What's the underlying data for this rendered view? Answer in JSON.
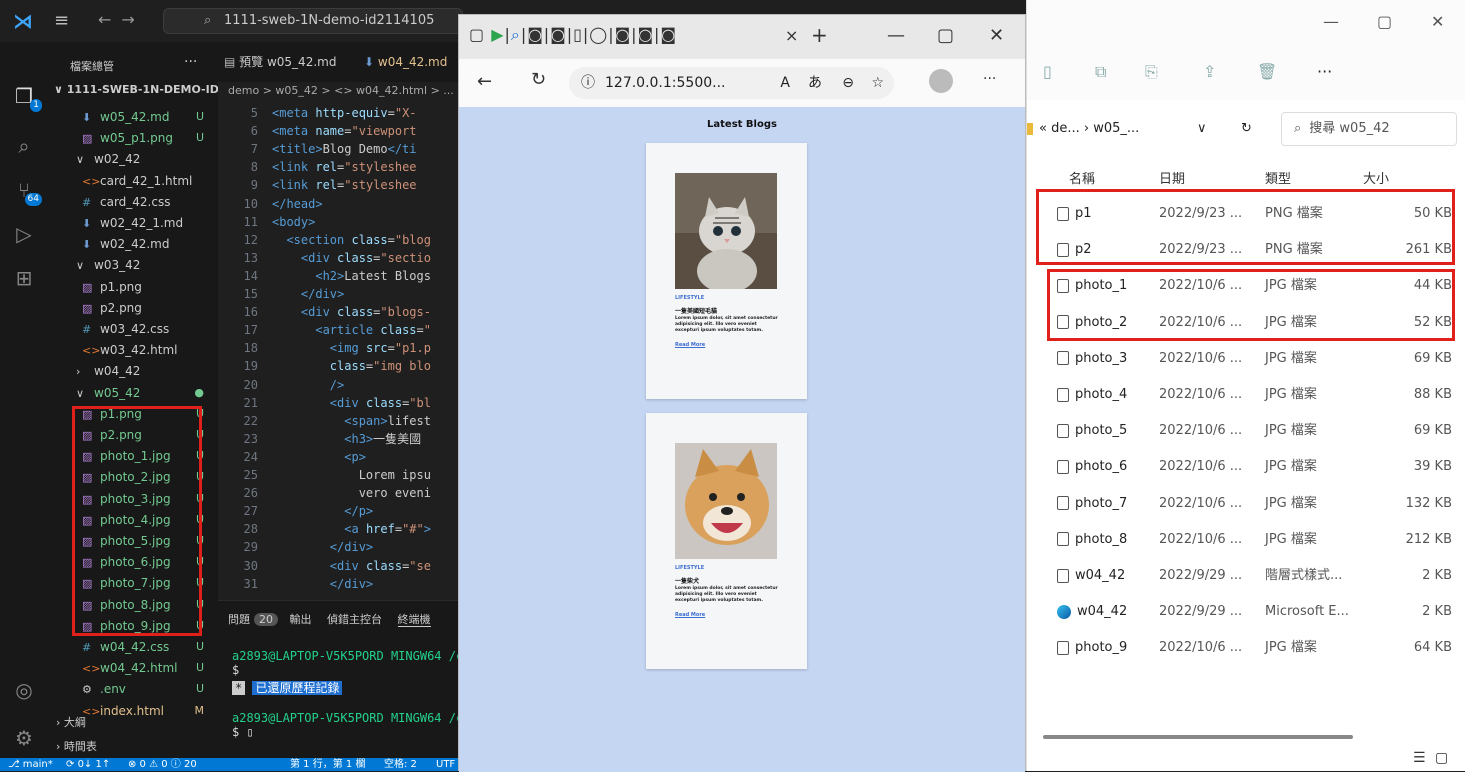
{
  "vscode": {
    "command_center": "1111-sweb-1N-demo-id2114105",
    "sidebar_title": "檔案總管",
    "sidebar_dots": "···",
    "project": "1111-SWEB-1N-DEMO-ID2...",
    "tree": [
      {
        "label": "w05_42.md",
        "icon": "md",
        "status": "U",
        "color": "green"
      },
      {
        "label": "w05_p1.png",
        "icon": "img",
        "status": "U",
        "color": "green"
      },
      {
        "label": "w02_42",
        "icon": "folder-open",
        "status": "",
        "color": "gray"
      },
      {
        "label": "card_42_1.html",
        "icon": "html",
        "status": "",
        "color": "gray"
      },
      {
        "label": "card_42.css",
        "icon": "css",
        "status": "",
        "color": "gray"
      },
      {
        "label": "w02_42_1.md",
        "icon": "md",
        "status": "",
        "color": "gray"
      },
      {
        "label": "w02_42.md",
        "icon": "md",
        "status": "",
        "color": "gray"
      },
      {
        "label": "w03_42",
        "icon": "folder-open",
        "status": "",
        "color": "gray"
      },
      {
        "label": "p1.png",
        "icon": "img",
        "status": "",
        "color": "gray"
      },
      {
        "label": "p2.png",
        "icon": "img",
        "status": "",
        "color": "gray"
      },
      {
        "label": "w03_42.css",
        "icon": "css",
        "status": "",
        "color": "gray"
      },
      {
        "label": "w03_42.html",
        "icon": "html",
        "status": "",
        "color": "gray"
      },
      {
        "label": "w04_42",
        "icon": "folder-closed",
        "status": "",
        "color": "gray"
      },
      {
        "label": "w05_42",
        "icon": "folder-open",
        "status": "●",
        "color": "green"
      },
      {
        "label": "p1.png",
        "icon": "img",
        "status": "U",
        "color": "green"
      },
      {
        "label": "p2.png",
        "icon": "img",
        "status": "U",
        "color": "green"
      },
      {
        "label": "photo_1.jpg",
        "icon": "img",
        "status": "U",
        "color": "green"
      },
      {
        "label": "photo_2.jpg",
        "icon": "img",
        "status": "U",
        "color": "green"
      },
      {
        "label": "photo_3.jpg",
        "icon": "img",
        "status": "U",
        "color": "green"
      },
      {
        "label": "photo_4.jpg",
        "icon": "img",
        "status": "U",
        "color": "green"
      },
      {
        "label": "photo_5.jpg",
        "icon": "img",
        "status": "U",
        "color": "green"
      },
      {
        "label": "photo_6.jpg",
        "icon": "img",
        "status": "U",
        "color": "green"
      },
      {
        "label": "photo_7.jpg",
        "icon": "img",
        "status": "U",
        "color": "green"
      },
      {
        "label": "photo_8.jpg",
        "icon": "img",
        "status": "U",
        "color": "green"
      },
      {
        "label": "photo_9.jpg",
        "icon": "img",
        "status": "U",
        "color": "green"
      },
      {
        "label": "w04_42.css",
        "icon": "css",
        "status": "U",
        "color": "green"
      },
      {
        "label": "w04_42.html",
        "icon": "html",
        "status": "U",
        "color": "green"
      },
      {
        "label": ".env",
        "icon": "gear",
        "status": "U",
        "color": "green"
      },
      {
        "label": "index.html",
        "icon": "html",
        "status": "M",
        "color": "yellow"
      }
    ],
    "outline": [
      "大綱",
      "時間表"
    ],
    "tabs": [
      "預覽 w05_42.md",
      "w04_42.md"
    ],
    "breadcrumb": "demo > w05_42 > <> w04_42.html > ...",
    "code": [
      {
        "n": "5",
        "html": "<span class='tg'>&lt;meta</span> <span class='at'>http-equiv</span>=<span class='sv'>\"X-</span>"
      },
      {
        "n": "6",
        "html": "<span class='tg'>&lt;meta</span> <span class='at'>name</span>=<span class='sv'>\"viewport</span>"
      },
      {
        "n": "7",
        "html": "<span class='tg'>&lt;title&gt;</span><span class='tx'>Blog Demo</span><span class='tg'>&lt;/ti</span>"
      },
      {
        "n": "8",
        "html": "<span class='tg'>&lt;link</span> <span class='at'>rel</span>=<span class='sv'>\"styleshee</span>"
      },
      {
        "n": "9",
        "html": "<span class='tg'>&lt;link</span> <span class='at'>rel</span>=<span class='sv'>\"styleshee</span>"
      },
      {
        "n": "10",
        "html": "<span class='tg'>&lt;/head&gt;</span>"
      },
      {
        "n": "11",
        "html": "<span class='tg'>&lt;body&gt;</span>"
      },
      {
        "n": "12",
        "html": "  <span class='tg'>&lt;section</span> <span class='at'>class</span>=<span class='sv'>\"blog</span>"
      },
      {
        "n": "13",
        "html": "    <span class='tg'>&lt;div</span> <span class='at'>class</span>=<span class='sv'>\"sectio</span>"
      },
      {
        "n": "14",
        "html": "      <span class='tg'>&lt;h2&gt;</span><span class='tx'>Latest Blogs</span>"
      },
      {
        "n": "15",
        "html": "    <span class='tg'>&lt;/div&gt;</span>"
      },
      {
        "n": "16",
        "html": "    <span class='tg'>&lt;div</span> <span class='at'>class</span>=<span class='sv'>\"blogs-</span>"
      },
      {
        "n": "17",
        "html": "      <span class='tg'>&lt;article</span> <span class='at'>class</span>=<span class='sv'>\"</span>"
      },
      {
        "n": "18",
        "html": "        <span class='tg'>&lt;img</span> <span class='at'>src</span>=<span class='sv'>\"p1.p</span>"
      },
      {
        "n": "19",
        "html": "        <span class='at'>class</span>=<span class='sv'>\"img blo</span>"
      },
      {
        "n": "20",
        "html": "        <span class='tg'>/&gt;</span>"
      },
      {
        "n": "21",
        "html": "        <span class='tg'>&lt;div</span> <span class='at'>class</span>=<span class='sv'>\"bl</span>"
      },
      {
        "n": "22",
        "html": "          <span class='tg'>&lt;span&gt;</span><span class='tx'>lifest</span>"
      },
      {
        "n": "23",
        "html": "          <span class='tg'>&lt;h3&gt;</span><span class='tx'>一隻美國</span>"
      },
      {
        "n": "24",
        "html": "          <span class='tg'>&lt;p&gt;</span>"
      },
      {
        "n": "25",
        "html": "            <span class='tx'>Lorem ipsu</span>"
      },
      {
        "n": "26",
        "html": "            <span class='tx'>vero eveni</span>"
      },
      {
        "n": "27",
        "html": "          <span class='tg'>&lt;/p&gt;</span>"
      },
      {
        "n": "28",
        "html": "          <span class='tg'>&lt;a</span> <span class='at'>href</span>=<span class='sv'>\"#\"</span><span class='tg'>&gt;</span>"
      },
      {
        "n": "29",
        "html": "        <span class='tg'>&lt;/div&gt;</span>"
      },
      {
        "n": "30",
        "html": "        <span class='tg'>&lt;div</span> <span class='at'>class</span>=<span class='sv'>\"se</span>"
      },
      {
        "n": "31",
        "html": "        <span class='tg'>&lt;/div&gt;</span>"
      }
    ],
    "panel": {
      "problems": "問題",
      "problems_count": "20",
      "output": "輸出",
      "debug": "偵錯主控台",
      "terminal": "終端機"
    },
    "terminal_lines": [
      "a2893@LAPTOP-V5K5PORD MINGW64 /c/",
      "$",
      "已還原歷程記錄",
      "a2893@LAPTOP-V5K5PORD MINGW64 /c/",
      "$ ▯"
    ],
    "status": {
      "branch": "main*",
      "sync": "0↓ 1↑",
      "problems": "⊗ 0 ⚠ 0 ⓘ 20",
      "position": "第 1 行，第 1 欄",
      "spaces": "空格: 2",
      "encoding": "UTF"
    }
  },
  "browser": {
    "url": "127.0.0.1:5500...",
    "page_title": "Latest Blogs",
    "cards": [
      {
        "category": "LIFESTYLE",
        "title": "一隻美國短毛貓",
        "body": "Lorem ipsum dolor, sit amet consectetur adipisicing elit. Illo vero eveniet excepturi ipsum voluptates totam.",
        "link": "Read More",
        "image": "cat-photo"
      },
      {
        "category": "LIFESTYLE",
        "title": "一隻柴犬",
        "body": "Lorem ipsum dolor, sit amet consectetur adipisicing elit. Illo vero eveniet excepturi ipsum voluptates totam.",
        "link": "Read More",
        "image": "dog-photo"
      }
    ]
  },
  "explorer": {
    "address": "« de... › w05_...",
    "search": "搜尋 w05_42",
    "columns": [
      "名稱",
      "日期",
      "類型",
      "大小"
    ],
    "files": [
      {
        "name": "p1",
        "date": "2022/9/23 ...",
        "type": "PNG 檔案",
        "size": "50 KB",
        "icon": "file"
      },
      {
        "name": "p2",
        "date": "2022/9/23 ...",
        "type": "PNG 檔案",
        "size": "261 KB",
        "icon": "file"
      },
      {
        "name": "photo_1",
        "date": "2022/10/6 ...",
        "type": "JPG 檔案",
        "size": "44 KB",
        "icon": "file"
      },
      {
        "name": "photo_2",
        "date": "2022/10/6 ...",
        "type": "JPG 檔案",
        "size": "52 KB",
        "icon": "file"
      },
      {
        "name": "photo_3",
        "date": "2022/10/6 ...",
        "type": "JPG 檔案",
        "size": "69 KB",
        "icon": "file"
      },
      {
        "name": "photo_4",
        "date": "2022/10/6 ...",
        "type": "JPG 檔案",
        "size": "88 KB",
        "icon": "file"
      },
      {
        "name": "photo_5",
        "date": "2022/10/6 ...",
        "type": "JPG 檔案",
        "size": "69 KB",
        "icon": "file"
      },
      {
        "name": "photo_6",
        "date": "2022/10/6 ...",
        "type": "JPG 檔案",
        "size": "39 KB",
        "icon": "file"
      },
      {
        "name": "photo_7",
        "date": "2022/10/6 ...",
        "type": "JPG 檔案",
        "size": "132 KB",
        "icon": "file"
      },
      {
        "name": "photo_8",
        "date": "2022/10/6 ...",
        "type": "JPG 檔案",
        "size": "212 KB",
        "icon": "file"
      },
      {
        "name": "w04_42",
        "date": "2022/9/29 ...",
        "type": "階層式樣式...",
        "size": "2 KB",
        "icon": "file"
      },
      {
        "name": "w04_42",
        "date": "2022/9/29 ...",
        "type": "Microsoft E...",
        "size": "2 KB",
        "icon": "edge"
      },
      {
        "name": "photo_9",
        "date": "2022/10/6 ...",
        "type": "JPG 檔案",
        "size": "64 KB",
        "icon": "file"
      }
    ]
  },
  "colors": {
    "accent": "#0078d4",
    "highlight": "#e0201a",
    "git_untracked": "#73c991",
    "git_modified": "#e2c08d"
  }
}
